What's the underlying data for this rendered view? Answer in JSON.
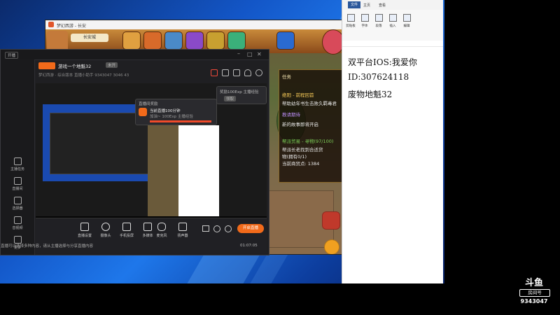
{
  "notepad": {
    "tabs": [
      "文件",
      "主页",
      "查看"
    ],
    "ribbon": [
      "剪贴板",
      "字体",
      "段落",
      "插入",
      "编辑"
    ],
    "lines": [
      "双平台IOS:我爱你",
      "ID:307624118",
      "废物地魁32"
    ]
  },
  "game": {
    "title": "梦幻西游 - 长安",
    "location": "长安城",
    "quest_lines": [
      {
        "text": "任务",
        "color": "#f2e3b0"
      },
      {
        "text": "绝阳 - 前程回首",
        "color": "#ffd15a"
      },
      {
        "text": "帮助幼年书生击败久羁毒君",
        "color": "#e8e8e8"
      },
      {
        "text": "教请期待",
        "color": "#b98cf2"
      },
      {
        "text": "新的故事即将开启",
        "color": "#e8e8e8"
      },
      {
        "text": "帮派贸易 - 寻物(97/100)",
        "color": "#7fd45a"
      },
      {
        "text": "帮派长老找到合适货",
        "color": "#e8e8e8"
      },
      {
        "text": "物(拥有0/1)",
        "color": "#e8e8e8"
      },
      {
        "text": "当前商贸点: 1384",
        "color": "#e8e8e8"
      }
    ]
  },
  "app": {
    "left_top": "开播",
    "room_title": "游戏一个地魁32",
    "status_badge": "未开",
    "stats_text": "梦幻西游 · 综合版本   直播小助手   9343047   3046   43",
    "sidebar": [
      {
        "label": "主播任务",
        "icon": "task-icon"
      },
      {
        "label": "直播间",
        "icon": "room-icon"
      },
      {
        "label": "选择器",
        "icon": "selector-icon"
      },
      {
        "label": "音视频",
        "icon": "media-icon"
      },
      {
        "label": "更多",
        "icon": "more-icon"
      }
    ],
    "notify_title": "直播间奖励",
    "notify_text": "当前直播100分钟",
    "notify_sub": "加油~ 100Exp 主播经验",
    "reward_text": "奖励100Exp 主播经验",
    "reward_button": "领取",
    "bottom_buttons": [
      "直播设置",
      "摄像头",
      "手机投屏",
      "多媒体",
      "麦克风",
      "扬声器"
    ],
    "start_button": "开启直播",
    "timer": "01:07:05",
    "footer_text": "直播可以选择多种内容，请从主播选择与分享直播内容"
  },
  "watermark": {
    "brand": "斗鱼",
    "room_label": "房间号",
    "room_number": "9343047"
  }
}
